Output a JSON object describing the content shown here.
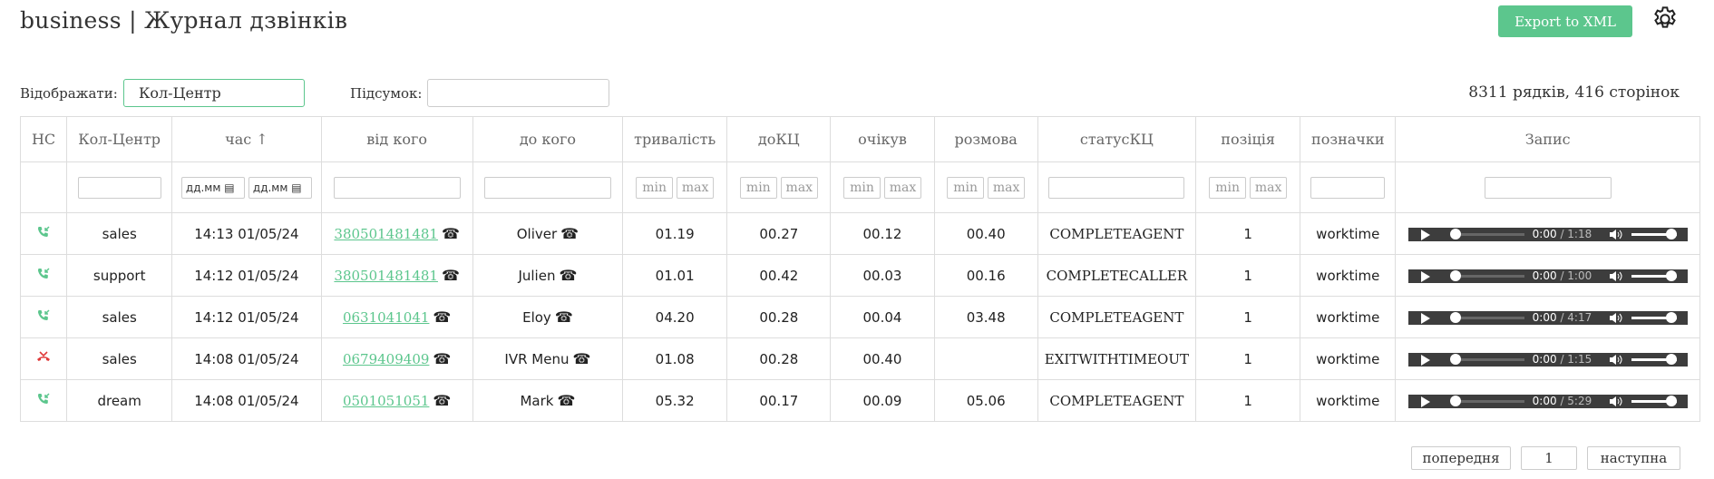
{
  "header": {
    "title": "business | Журнал дзвінків",
    "export_label": "Export to XML"
  },
  "filters": {
    "show_label": "Відображати:",
    "show_value": "Кол-Центр",
    "summary_label": "Підсумок:",
    "summary_value": ""
  },
  "stats": {
    "text": "8311 рядків, 416 сторінок"
  },
  "columns": [
    "НС",
    "Кол-Центр",
    "час ↑",
    "від кого",
    "до кого",
    "тривалість",
    "доКЦ",
    "очікув",
    "розмова",
    "статусКЦ",
    "позіція",
    "позначки",
    "Запис"
  ],
  "filter_row": {
    "min": "min",
    "max": "max",
    "date_placeholder": "дд.мм"
  },
  "rows": [
    {
      "direction": "answered",
      "cc": "sales",
      "time": "14:13 01/05/24",
      "from": "380501481481",
      "to": "Oliver",
      "duration": "01.19",
      "to_cc": "00.27",
      "wait": "00.12",
      "talk": "00.40",
      "status": "COMPLETEAGENT",
      "position": "1",
      "tags": "worktime",
      "rec_current": "0:00",
      "rec_total": "1:18"
    },
    {
      "direction": "answered",
      "cc": "support",
      "time": "14:12 01/05/24",
      "from": "380501481481",
      "to": "Julien",
      "duration": "01.01",
      "to_cc": "00.42",
      "wait": "00.03",
      "talk": "00.16",
      "status": "COMPLETECALLER",
      "position": "1",
      "tags": "worktime",
      "rec_current": "0:00",
      "rec_total": "1:00"
    },
    {
      "direction": "answered",
      "cc": "sales",
      "time": "14:12 01/05/24",
      "from": "0631041041",
      "to": "Eloy",
      "duration": "04.20",
      "to_cc": "00.28",
      "wait": "00.04",
      "talk": "03.48",
      "status": "COMPLETEAGENT",
      "position": "1",
      "tags": "worktime",
      "rec_current": "0:00",
      "rec_total": "4:17"
    },
    {
      "direction": "missed",
      "cc": "sales",
      "time": "14:08 01/05/24",
      "from": "0679409409",
      "to": "IVR Menu",
      "duration": "01.08",
      "to_cc": "00.28",
      "wait": "00.40",
      "talk": "",
      "status": "EXITWITHTIMEOUT",
      "position": "1",
      "tags": "worktime",
      "rec_current": "0:00",
      "rec_total": "1:15"
    },
    {
      "direction": "answered",
      "cc": "dream",
      "time": "14:08 01/05/24",
      "from": "0501051051",
      "to": "Mark",
      "duration": "05.32",
      "to_cc": "00.17",
      "wait": "00.09",
      "talk": "05.06",
      "status": "COMPLETEAGENT",
      "position": "1",
      "tags": "worktime",
      "rec_current": "0:00",
      "rec_total": "5:29"
    }
  ],
  "pagination": {
    "prev_label": "попередня",
    "page": "1",
    "next_label": "наступна"
  },
  "colors": {
    "accent": "#5cc68d",
    "missed": "#e03a3a",
    "player_bg": "#3d3d3d"
  },
  "icons": {
    "settings": "gear-icon",
    "answered": "phone-incoming-icon",
    "missed": "phone-missed-icon",
    "phone": "phone-icon"
  }
}
